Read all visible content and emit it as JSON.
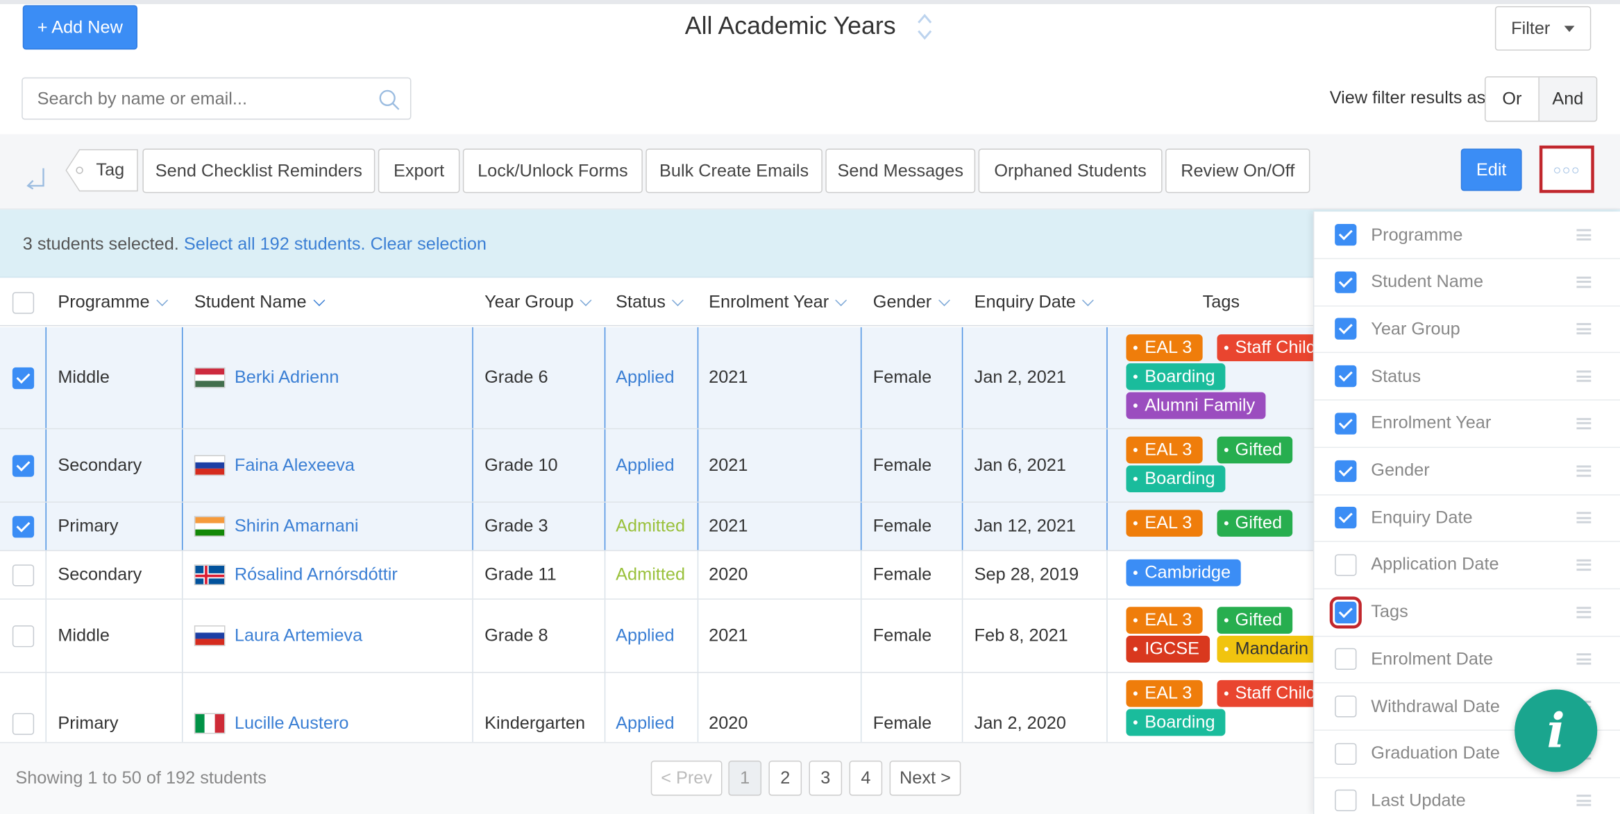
{
  "header": {
    "add_new_label": "+ Add New",
    "title": "All Academic Years",
    "filter_label": "Filter",
    "search_placeholder": "Search by name or email...",
    "view_filter_label": "View filter results as:",
    "or_label": "Or",
    "and_label": "And"
  },
  "toolbar": {
    "tag_label": "Tag",
    "buttons": [
      "Send Checklist Reminders",
      "Export",
      "Lock/Unlock Forms",
      "Bulk Create Emails",
      "Send Messages",
      "Orphaned Students",
      "Review On/Off"
    ],
    "edit_label": "Edit",
    "more_label": "○○○"
  },
  "selection": {
    "text": "3 students selected.",
    "select_all": "Select all 192 students.",
    "clear": "Clear selection"
  },
  "table": {
    "columns": [
      "Programme",
      "Student Name",
      "Year Group",
      "Status",
      "Enrolment Year",
      "Gender",
      "Enquiry Date",
      "Tags"
    ],
    "rows": [
      {
        "selected": true,
        "programme": "Middle",
        "name": "Berki Adrienn",
        "flag": "hungary-flag-icon",
        "year_group": "Grade 6",
        "status": "Applied",
        "enrolment_year": "2021",
        "gender": "Female",
        "enquiry_date": "Jan 2, 2021",
        "tags": [
          "EAL 3",
          "Staff Child",
          "Boarding",
          "Alumni Family"
        ]
      },
      {
        "selected": true,
        "programme": "Secondary",
        "name": "Faina Alexeeva",
        "flag": "russia-flag-icon",
        "year_group": "Grade 10",
        "status": "Applied",
        "enrolment_year": "2021",
        "gender": "Female",
        "enquiry_date": "Jan 6, 2021",
        "tags": [
          "EAL 3",
          "Gifted",
          "Boarding"
        ]
      },
      {
        "selected": true,
        "programme": "Primary",
        "name": "Shirin Amarnani",
        "flag": "india-flag-icon",
        "year_group": "Grade 3",
        "status": "Admitted",
        "enrolment_year": "2021",
        "gender": "Female",
        "enquiry_date": "Jan 12, 2021",
        "tags": [
          "EAL 3",
          "Gifted"
        ]
      },
      {
        "selected": false,
        "programme": "Secondary",
        "name": "Rósalind Arnórsdóttir",
        "flag": "iceland-flag-icon",
        "year_group": "Grade 11",
        "status": "Admitted",
        "enrolment_year": "2020",
        "gender": "Female",
        "enquiry_date": "Sep 28, 2019",
        "tags": [
          "Cambridge"
        ]
      },
      {
        "selected": false,
        "programme": "Middle",
        "name": "Laura Artemieva",
        "flag": "russia-flag-icon",
        "year_group": "Grade 8",
        "status": "Applied",
        "enrolment_year": "2021",
        "gender": "Female",
        "enquiry_date": "Feb 8, 2021",
        "tags": [
          "EAL 3",
          "Gifted",
          "IGCSE",
          "Mandarin"
        ]
      },
      {
        "selected": false,
        "programme": "Primary",
        "name": "Lucille Austero",
        "flag": "italy-flag-icon",
        "year_group": "Kindergarten",
        "status": "Applied",
        "enrolment_year": "2020",
        "gender": "Female",
        "enquiry_date": "Jan 2, 2020",
        "tags": [
          "EAL 3",
          "Staff Child",
          "Boarding"
        ]
      }
    ]
  },
  "tag_colors": {
    "EAL 3": "#ef7d0b",
    "Staff Child": "#e9452f",
    "Boarding": "#1abc9c",
    "Alumni Family": "#9b4dbf",
    "Gifted": "#27ae4f",
    "Cambridge": "#3b8df5",
    "IGCSE": "#d9381e",
    "Mandarin": "#f1c40f"
  },
  "footer": {
    "showing": "Showing 1 to 50 of 192 students",
    "prev": "< Prev",
    "pages": [
      "1",
      "2",
      "3",
      "4"
    ],
    "next": "Next >"
  },
  "columns_panel": {
    "items": [
      {
        "label": "Programme",
        "checked": true
      },
      {
        "label": "Student Name",
        "checked": true
      },
      {
        "label": "Year Group",
        "checked": true
      },
      {
        "label": "Status",
        "checked": true
      },
      {
        "label": "Enrolment Year",
        "checked": true
      },
      {
        "label": "Gender",
        "checked": true
      },
      {
        "label": "Enquiry Date",
        "checked": true
      },
      {
        "label": "Application Date",
        "checked": false
      },
      {
        "label": "Tags",
        "checked": true
      },
      {
        "label": "Enrolment Date",
        "checked": false
      },
      {
        "label": "Withdrawal Date",
        "checked": false
      },
      {
        "label": "Graduation Date",
        "checked": false
      },
      {
        "label": "Last Update",
        "checked": false
      }
    ]
  },
  "info_button": {
    "label": "i",
    "color": "#1aa58e"
  }
}
